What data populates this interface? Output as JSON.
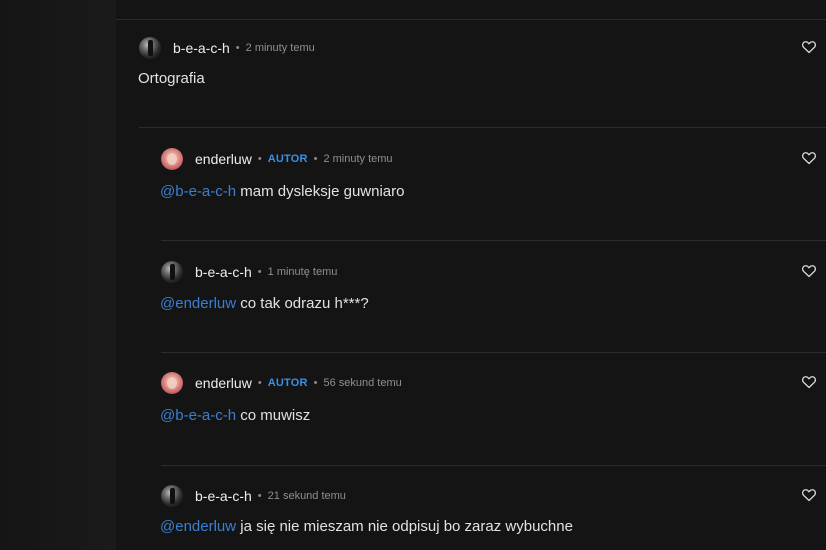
{
  "comments": [
    {
      "user": "b-e-a-c-h",
      "badge": "",
      "time": "2 minuty temu",
      "mention": "",
      "text": "Ortografia",
      "avatar_icon": "user-avatar-dark"
    },
    {
      "user": "enderluw",
      "badge": "AUTOR",
      "time": "2 minuty temu",
      "mention": "@b-e-a-c-h",
      "text": " mam dysleksje guwniaro",
      "avatar_icon": "user-avatar-pink"
    },
    {
      "user": "b-e-a-c-h",
      "badge": "",
      "time": "1 minutę temu",
      "mention": "@enderluw",
      "text": " co tak odrazu h***?",
      "avatar_icon": "user-avatar-dark"
    },
    {
      "user": "enderluw",
      "badge": "AUTOR",
      "time": "56 sekund temu",
      "mention": "@b-e-a-c-h",
      "text": " co muwisz",
      "avatar_icon": "user-avatar-pink"
    },
    {
      "user": "b-e-a-c-h",
      "badge": "",
      "time": "21 sekund temu",
      "mention": "@enderluw",
      "text": " ja się nie mieszam nie odpisuj bo zaraz wybuchne",
      "avatar_icon": "user-avatar-dark"
    }
  ],
  "separator": "•",
  "colors": {
    "background": "#141414",
    "badge": "#3b8fe6",
    "mention": "#3b7fd0",
    "text": "#e2e2e2",
    "meta": "#8f8f8f"
  },
  "icons": {
    "like": "heart-outline-icon"
  }
}
